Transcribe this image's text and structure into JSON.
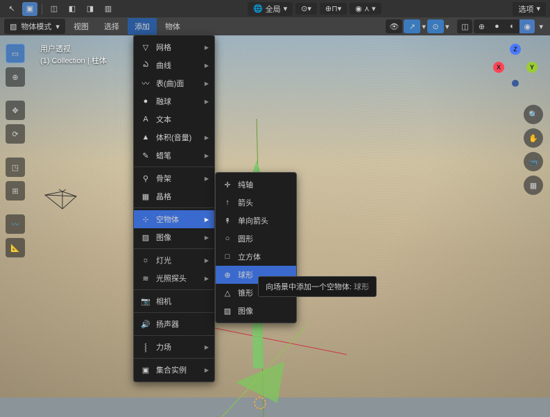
{
  "topbar": {
    "scope_label": "全局",
    "options_label": "选项"
  },
  "header": {
    "mode": "物体模式",
    "menus": {
      "view": "视图",
      "select": "选择",
      "add": "添加",
      "object": "物体"
    }
  },
  "info": {
    "perspective": "用户透视",
    "collection": "(1) Collection | 柱体"
  },
  "axes": {
    "x": "X",
    "y": "Y",
    "z": "Z"
  },
  "add_menu": {
    "items": [
      {
        "label": "网格",
        "icon": "▽",
        "sub": true
      },
      {
        "label": "曲线",
        "icon": "ఎ",
        "sub": true
      },
      {
        "label": "表(曲)面",
        "icon": "〰",
        "sub": true
      },
      {
        "label": "融球",
        "icon": "●",
        "sub": true
      },
      {
        "label": "文本",
        "icon": "A",
        "sub": false
      },
      {
        "label": "体积(音量)",
        "icon": "▲",
        "sub": true
      },
      {
        "label": "蜡笔",
        "icon": "✎",
        "sub": true
      },
      {
        "label": "骨架",
        "icon": "⚲",
        "sub": true
      },
      {
        "label": "晶格",
        "icon": "▦",
        "sub": false
      },
      {
        "label": "空物体",
        "icon": "⊹",
        "sub": true
      },
      {
        "label": "图像",
        "icon": "▨",
        "sub": true
      },
      {
        "label": "灯光",
        "icon": "☼",
        "sub": true
      },
      {
        "label": "光照探头",
        "icon": "≋",
        "sub": true
      },
      {
        "label": "相机",
        "icon": "📷",
        "sub": false
      },
      {
        "label": "扬声器",
        "icon": "🔊",
        "sub": false
      },
      {
        "label": "力场",
        "icon": "⸾",
        "sub": true
      },
      {
        "label": "集合实例",
        "icon": "▣",
        "sub": true
      }
    ]
  },
  "empty_submenu": {
    "items": [
      {
        "label": "纯轴",
        "icon": "✛"
      },
      {
        "label": "箭头",
        "icon": "↑"
      },
      {
        "label": "单向箭头",
        "icon": "↟"
      },
      {
        "label": "圆形",
        "icon": "○"
      },
      {
        "label": "立方体",
        "icon": "□"
      },
      {
        "label": "球形",
        "icon": "⊕"
      },
      {
        "label": "锥形",
        "icon": "△"
      },
      {
        "label": "图像",
        "icon": "▨"
      }
    ]
  },
  "tooltip": {
    "text": "向场景中添加一个空物体:",
    "highlight": "球形"
  }
}
